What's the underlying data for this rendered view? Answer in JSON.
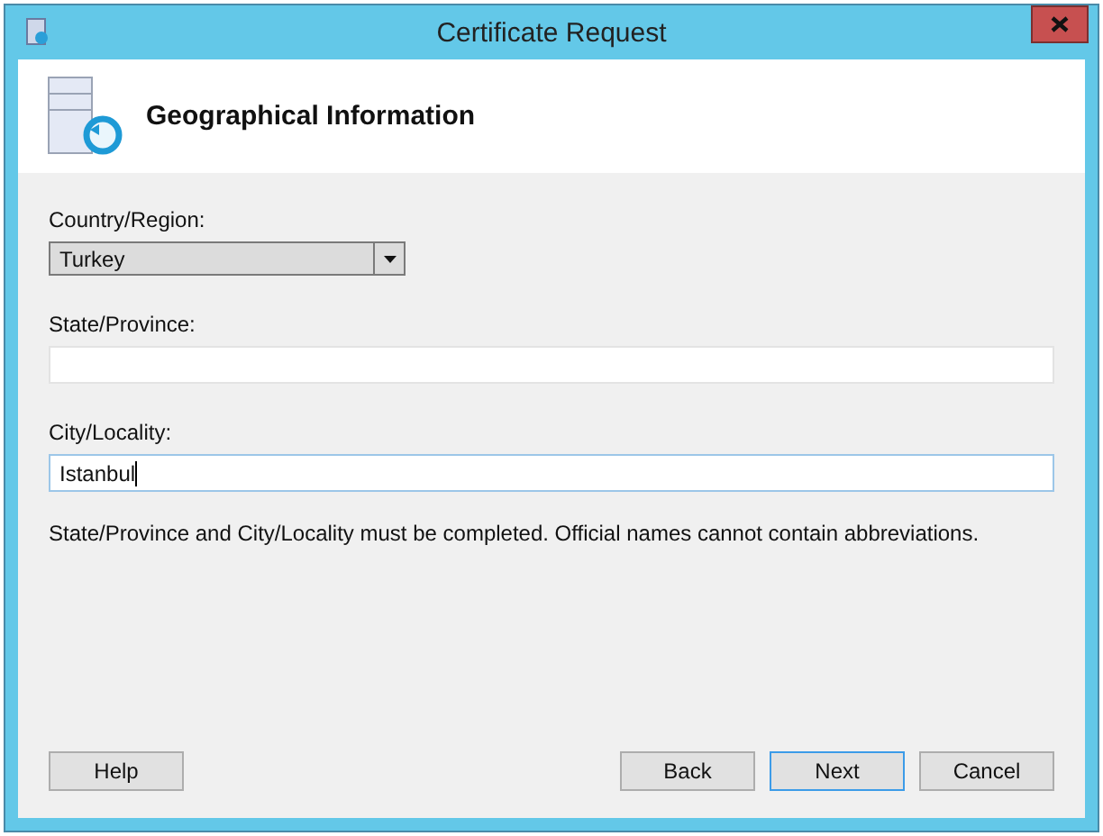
{
  "window": {
    "title": "Certificate Request"
  },
  "header": {
    "title": "Geographical Information"
  },
  "fields": [
    {
      "kind": "dropdown",
      "label": "Country/Region:",
      "value": "Turkey"
    },
    {
      "kind": "text",
      "label": "State/Province:",
      "focused": false
    },
    {
      "kind": "text",
      "label": "City/Locality:",
      "value": "Istanbul",
      "focused": true
    }
  ],
  "note": "State/Province and City/Locality must be completed. Official names cannot contain abbreviations.",
  "left_buttons": [
    {
      "label": "Help",
      "default": false
    }
  ],
  "right_buttons": [
    {
      "label": "Back",
      "default": false
    },
    {
      "label": "Next",
      "default": true
    },
    {
      "label": "Cancel",
      "default": false
    }
  ]
}
